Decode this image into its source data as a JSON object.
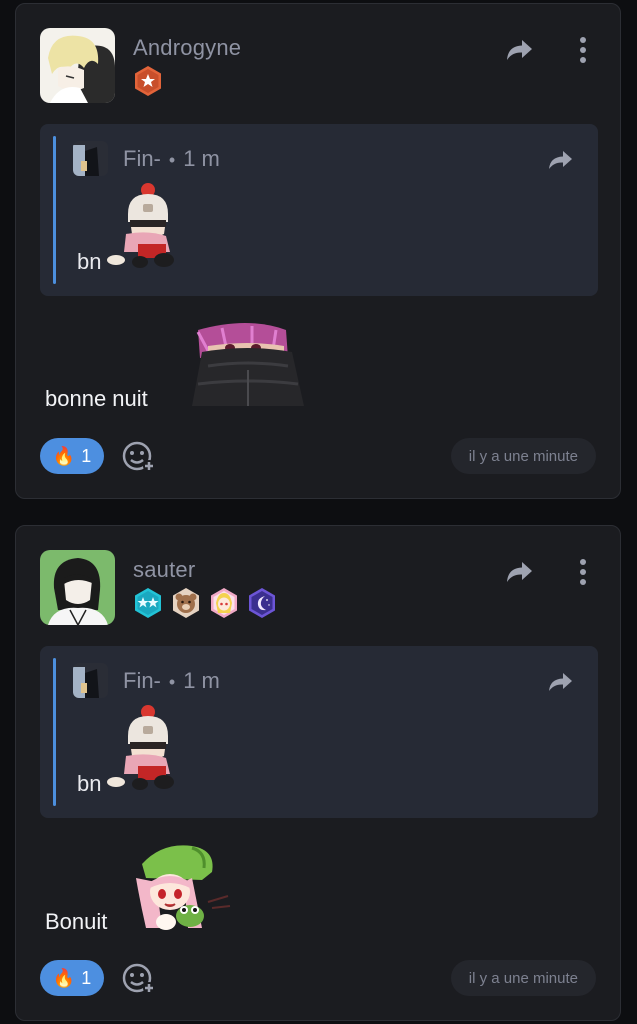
{
  "posts": [
    {
      "author": "Androgyne",
      "badges": [
        "orange-star-badge"
      ],
      "quote": {
        "author": "Fin-",
        "separator": "•",
        "time": "1 m",
        "text": "bn"
      },
      "message": "bonne nuit",
      "reaction": {
        "emoji": "🔥",
        "count": "1"
      },
      "timestamp": "il y a une minute"
    },
    {
      "author": "sauter",
      "badges": [
        "cyan-stars-badge",
        "bear-badge",
        "anime-girl-badge",
        "moon-badge"
      ],
      "quote": {
        "author": "Fin-",
        "separator": "•",
        "time": "1 m",
        "text": "bn"
      },
      "message": "Bonuit",
      "reaction": {
        "emoji": "🔥",
        "count": "1"
      },
      "timestamp": "il y a une minute"
    }
  ],
  "colors": {
    "background": "#0d0e11",
    "card": "#1b1c20",
    "quote_bg": "#262a35",
    "accent_blue": "#4d8fe0",
    "muted_text": "#8f93a3"
  }
}
